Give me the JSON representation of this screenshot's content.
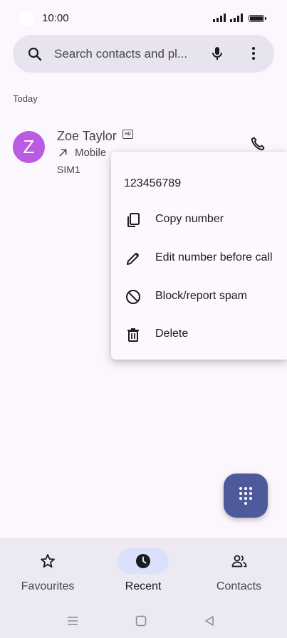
{
  "status_bar": {
    "time": "10:00"
  },
  "search": {
    "placeholder": "Search contacts and pl..."
  },
  "recents": {
    "section_label": "Today",
    "calls": [
      {
        "avatar_letter": "Z",
        "avatar_color": "#b95ce3",
        "name": "Zoe Taylor",
        "hd_badge": "HD",
        "call_type": "Mobile",
        "sim": "SIM1"
      }
    ]
  },
  "context_menu": {
    "number": "123456789",
    "items": [
      {
        "label": "Copy number",
        "icon": "copy-icon"
      },
      {
        "label": "Edit number before call",
        "icon": "pencil-icon"
      },
      {
        "label": "Block/report spam",
        "icon": "block-icon"
      },
      {
        "label": "Delete",
        "icon": "trash-icon"
      }
    ]
  },
  "fab": {
    "icon": "dialpad-icon"
  },
  "bottom_nav": {
    "items": [
      {
        "label": "Favourites",
        "icon": "star-icon",
        "active": false
      },
      {
        "label": "Recent",
        "icon": "clock-icon",
        "active": true
      },
      {
        "label": "Contacts",
        "icon": "people-icon",
        "active": false
      }
    ]
  },
  "colors": {
    "background": "#fcf7fd",
    "search_bar": "#e8e4ef",
    "accent": "#4e5a9a",
    "active_pill": "#dbe1fb",
    "nav_background": "#ece9f3"
  }
}
